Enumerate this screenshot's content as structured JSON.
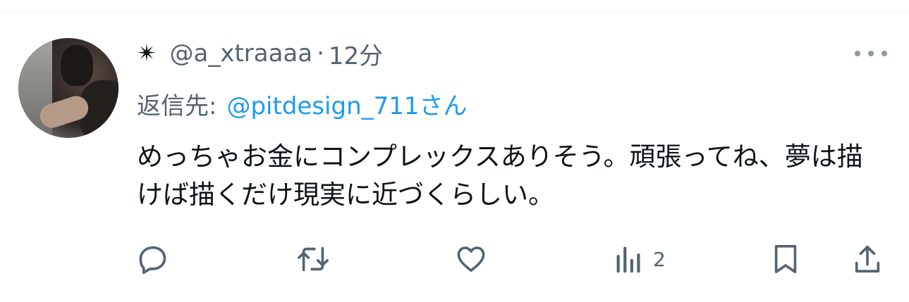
{
  "tweet": {
    "star": "✴",
    "handle": "@a_xtraaaa",
    "separator": "·",
    "time": "12分",
    "reply_prefix": "返信先:",
    "reply_to": "@pitdesign_711さん",
    "text": "めっちゃお金にコンプレックスありそう。頑張ってね、夢は描けば描くだけ現実に近づくらしい。"
  },
  "actions": {
    "reply_icon": "reply-icon",
    "retweet_icon": "retweet-icon",
    "like_icon": "heart-icon",
    "views_icon": "views-chart-icon",
    "views_count": "2",
    "bookmark_icon": "bookmark-icon",
    "share_icon": "share-icon"
  },
  "colors": {
    "text": "#0f1419",
    "secondary": "#536471",
    "link": "#1d9bf0",
    "divider": "#eff3f4"
  }
}
